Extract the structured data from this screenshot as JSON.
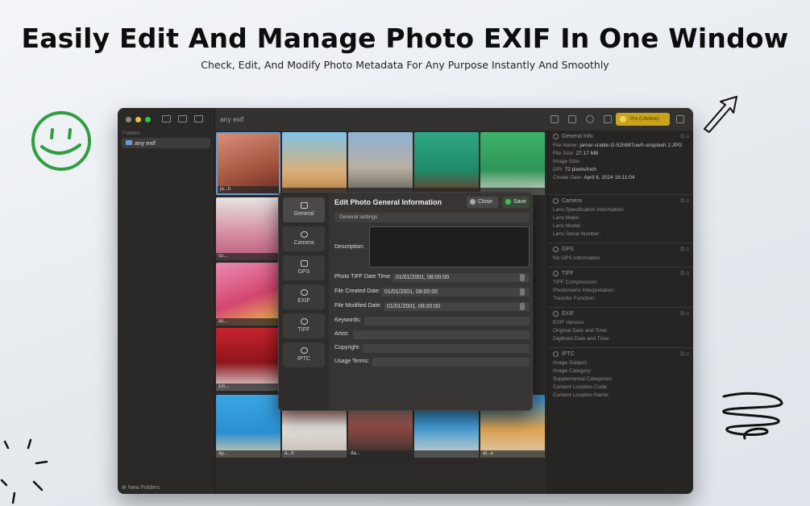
{
  "hero": {
    "title": "Easily Edit And Manage Photo EXIF In One Window",
    "subtitle": "Check, Edit, And Modify Photo Metadata For Any Purpose Instantly And Smoothly"
  },
  "colors": {
    "accent_green": "#2f9e3f",
    "upgrade": "#c9a41b",
    "save": "#3f8f3f"
  },
  "sidebar": {
    "section_label": "Folders",
    "folder": "any exif",
    "new_folder": "New Folders"
  },
  "toolbar": {
    "window_title": "any exif",
    "upgrade_label": "Pro (Lifetime)"
  },
  "thumbs": [
    {
      "cap": "ja...h"
    },
    {
      "cap": ""
    },
    {
      "cap": ""
    },
    {
      "cap": ""
    },
    {
      "cap": ""
    },
    {
      "cap": "cu..."
    },
    {
      "cap": "as..."
    },
    {
      "cap": "1m..."
    },
    {
      "cap": "ay..."
    },
    {
      "cap": "a...h"
    },
    {
      "cap": "da..."
    },
    {
      "cap": ""
    },
    {
      "cap": "al...e"
    }
  ],
  "modal": {
    "title": "Edit Photo General Information",
    "close_label": "Close",
    "save_label": "Save",
    "section_tab": "General settings",
    "tabs": [
      "General",
      "Camera",
      "GPS",
      "EXIF",
      "TIFF",
      "IPTC"
    ],
    "description_label": "Description:",
    "tiff_label": "Photo TIFF Date Time:",
    "tiff_value": "01/01/2001, 08:00:00",
    "created_label": "File Created Date:",
    "created_value": "01/01/2001, 08:00:00",
    "modified_label": "File Modified Date:",
    "modified_value": "01/01/2001, 08:00:00",
    "keywords_label": "Keywords:",
    "artist_label": "Artist:",
    "copyright_label": "Copyright:",
    "usage_label": "Usage Terms:"
  },
  "info": {
    "general": {
      "title": "General Info",
      "file_name_label": "File Name:",
      "file_name": "jamar-crable-G-52hMt7uw0-unsplash 2.JPG",
      "file_size_label": "File Size:",
      "file_size": "27.17 MB",
      "image_size_label": "Image Size:",
      "dpi_label": "DPI:",
      "dpi": "72 pixels/inch",
      "create_date_label": "Create Date:",
      "create_date": "April 8, 2024 16:11:04"
    },
    "camera": {
      "title": "Camera",
      "f1": "Lens Specification Information:",
      "f2": "Lens Make:",
      "f3": "Lens Model:",
      "f4": "Lens Serial Number:"
    },
    "gps": {
      "title": "GPS",
      "f1": "No GPS Information"
    },
    "tiff": {
      "title": "TIFF",
      "f1": "TIFF Compression:",
      "f2": "Photometric Interpretation:",
      "f3": "Transfer Function:"
    },
    "exif": {
      "title": "EXIF",
      "f1": "EXIF Version:",
      "f2": "Original Date and Time:",
      "f3": "Digitized Date and Time:"
    },
    "iptc": {
      "title": "IPTC",
      "f1": "Image Subject:",
      "f2": "Image Category:",
      "f3": "Supplemental Categories:",
      "f4": "Content Location Code:",
      "f5": "Content Location Name:"
    }
  }
}
